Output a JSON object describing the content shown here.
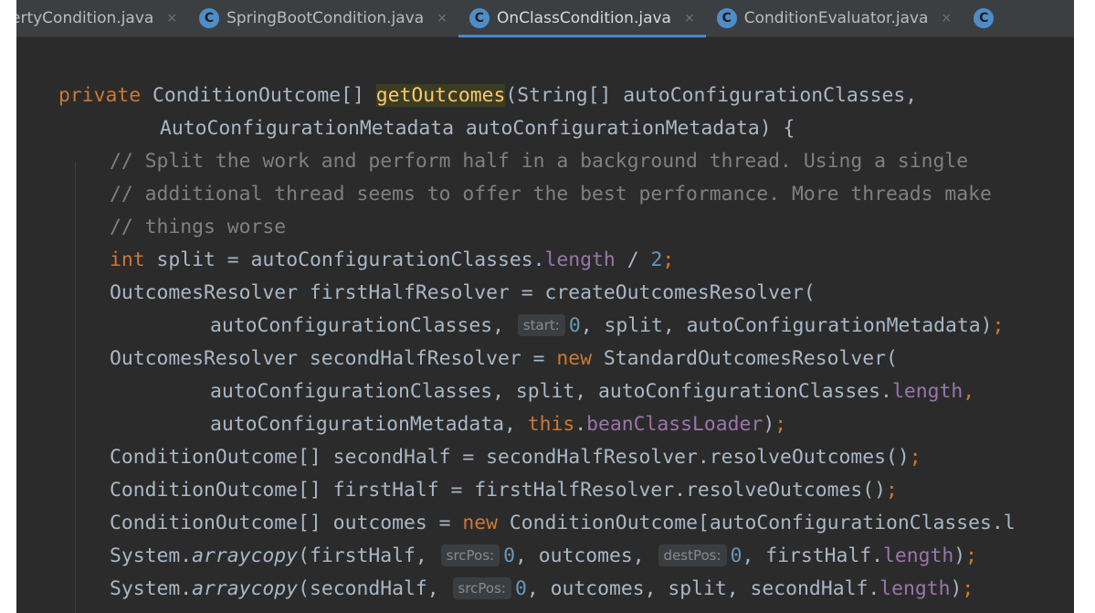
{
  "tabs": [
    {
      "label": "ertyCondition.java",
      "active": false,
      "has_icon": false
    },
    {
      "label": "SpringBootCondition.java",
      "active": false,
      "has_icon": true
    },
    {
      "label": "OnClassCondition.java",
      "active": true,
      "has_icon": true
    },
    {
      "label": "ConditionEvaluator.java",
      "active": false,
      "has_icon": true
    }
  ],
  "icons": {
    "class_icon": "C",
    "close_icon": "×"
  },
  "code": {
    "l1": {
      "kw": "private",
      "type": "ConditionOutcome[]",
      "method": "getOutcomes",
      "params": "(String[] autoConfigurationClasses,"
    },
    "l2": "AutoConfigurationMetadata autoConfigurationMetadata) {",
    "l3": "// Split the work and perform half in a background thread. Using a single",
    "l4": "// additional thread seems to offer the best performance. More threads make",
    "l5": "// things worse",
    "l6": {
      "kw": "int",
      "a": "split = autoConfigurationClasses.",
      "field": "length",
      "b": "/",
      "num": "2",
      "semi": ";"
    },
    "l7": "OutcomesResolver firstHalfResolver = createOutcomesResolver(",
    "l8": {
      "a": "autoConfigurationClasses,",
      "hint": "start:",
      "num": "0",
      "b": ", split, autoConfigurationMetadata)",
      "semi": ";"
    },
    "l9": {
      "a": "OutcomesResolver secondHalfResolver =",
      "kw": "new",
      "b": "StandardOutcomesResolver("
    },
    "l10": {
      "a": "autoConfigurationClasses, split, autoConfigurationClasses.",
      "field": "length",
      "comma": ","
    },
    "l11": {
      "a": "autoConfigurationMetadata,",
      "kw": "this",
      "dot": ".",
      "field": "beanClassLoader",
      "b": ")",
      "semi": ";"
    },
    "l12": {
      "a": "ConditionOutcome[] secondHalf = secondHalfResolver.resolveOutcomes()",
      "semi": ";"
    },
    "l13": {
      "a": "ConditionOutcome[] firstHalf = firstHalfResolver.resolveOutcomes()",
      "semi": ";"
    },
    "l14": {
      "a": "ConditionOutcome[] outcomes =",
      "kw": "new",
      "b": "ConditionOutcome[autoConfigurationClasses.l"
    },
    "l15": {
      "a": "System.",
      "italic": "arraycopy",
      "b": "(firstHalf,",
      "hint1": "srcPos:",
      "num1": "0",
      "c": ", outcomes,",
      "hint2": "destPos:",
      "num2": "0",
      "d": ", firstHalf.",
      "field": "length",
      "e": ")",
      "semi": ";"
    },
    "l16": {
      "a": "System.",
      "italic": "arraycopy",
      "b": "(secondHalf,",
      "hint": "srcPos:",
      "num": "0",
      "c": ", outcomes, split, secondHalf.",
      "field": "length",
      "d": ")",
      "semi": ";"
    }
  }
}
